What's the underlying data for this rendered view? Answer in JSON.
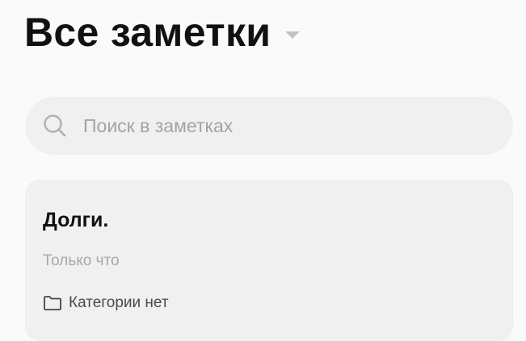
{
  "header": {
    "title": "Все заметки",
    "dropdown_icon": "caret-down-icon"
  },
  "search": {
    "placeholder": "Поиск в заметках",
    "value": "",
    "icon": "search-icon"
  },
  "notes": [
    {
      "title": "Долги.",
      "timestamp": "Только что",
      "category_icon": "folder-icon",
      "category": "Категории нет"
    }
  ],
  "colors": {
    "background": "#fafafa",
    "card": "#f0f0f0",
    "title_text": "#111111",
    "secondary_text": "#a8a8a8",
    "caret": "#c2c2c2"
  }
}
